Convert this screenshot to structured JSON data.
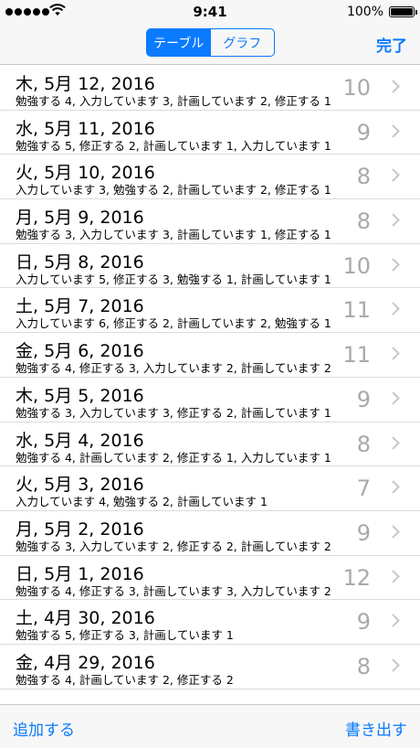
{
  "status_bar": {
    "time": "9:41",
    "battery": "100%"
  },
  "segments": [
    {
      "label": "テーブル",
      "selected": true
    },
    {
      "label": "グラフ",
      "selected": false
    }
  ],
  "nav": {
    "done_label": "完了"
  },
  "rows": [
    {
      "title": "木, 5月 12, 2016",
      "subtitle": "勉強する 4, 入力しています 3, 計画しています 2, 修正する 1",
      "count": "10"
    },
    {
      "title": "水, 5月 11, 2016",
      "subtitle": "勉強する 5, 修正する 2, 計画しています 1, 入力しています 1",
      "count": "9"
    },
    {
      "title": "火, 5月 10, 2016",
      "subtitle": "入力しています 3, 勉強する 2, 計画しています 2, 修正する 1",
      "count": "8"
    },
    {
      "title": "月, 5月 9, 2016",
      "subtitle": "勉強する 3, 入力しています 3, 計画しています 1, 修正する 1",
      "count": "8"
    },
    {
      "title": "日, 5月 8, 2016",
      "subtitle": "入力しています 5, 修正する 3, 勉強する 1, 計画しています 1",
      "count": "10"
    },
    {
      "title": "土, 5月 7, 2016",
      "subtitle": "入力しています 6, 修正する 2, 計画しています 2, 勉強する 1",
      "count": "11"
    },
    {
      "title": "金, 5月 6, 2016",
      "subtitle": "勉強する 4, 修正する 3, 入力しています 2, 計画しています 2",
      "count": "11"
    },
    {
      "title": "木, 5月 5, 2016",
      "subtitle": "勉強する 3, 入力しています 3, 修正する 2, 計画しています 1",
      "count": "9"
    },
    {
      "title": "水, 5月 4, 2016",
      "subtitle": "勉強する 4, 計画しています 2, 修正する 1, 入力しています 1",
      "count": "8"
    },
    {
      "title": "火, 5月 3, 2016",
      "subtitle": "入力しています 4, 勉強する 2, 計画しています 1",
      "count": "7"
    },
    {
      "title": "月, 5月 2, 2016",
      "subtitle": "勉強する 3, 入力しています 2, 修正する 2, 計画しています 2",
      "count": "9"
    },
    {
      "title": "日, 5月 1, 2016",
      "subtitle": "勉強する 4, 修正する 3, 計画しています 3, 入力しています 2",
      "count": "12"
    },
    {
      "title": "土, 4月 30, 2016",
      "subtitle": "勉強する 5, 修正する 3, 計画しています 1",
      "count": "9"
    },
    {
      "title": "金, 4月 29, 2016",
      "subtitle": "勉強する 4, 計画しています 2, 修正する 2",
      "count": "8"
    }
  ],
  "toolbar": {
    "add_label": "追加する",
    "export_label": "書き出す"
  },
  "colors": {
    "accent": "#0a7aff",
    "count_gray": "#a9a9ad",
    "chevron": "#c7c7cc"
  },
  "icons": {
    "row_accessory": "chevron-right-icon",
    "wifi": "wifi-icon"
  }
}
